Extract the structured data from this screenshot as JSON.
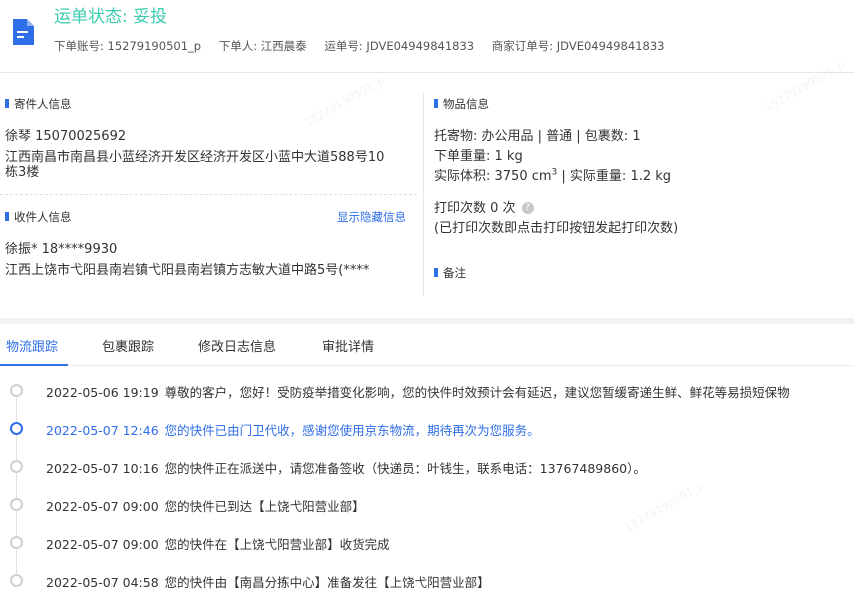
{
  "header": {
    "status_title": "运单状态: 妥投",
    "order_account": "下单账号: 15279190501_p",
    "orderer": "下单人: 江西晨泰",
    "waybill_no": "运单号: JDVE04949841833",
    "merchant_order_no": "商家订单号: JDVE04949841833",
    "icon": "document-icon",
    "title_color": "#3ccdb0"
  },
  "sender": {
    "section_title": "寄件人信息",
    "name_phone": "徐琴   15070025692",
    "address_line1": "江西南昌市南昌县小蓝经济开发区经济开发区小蓝中大道588号10",
    "address_line2": "栋3楼"
  },
  "receiver": {
    "section_title": "收件人信息",
    "toggle_link": "显示隐藏信息",
    "name_phone": "徐振*   18****9930",
    "address": "江西上饶市弋阳县南岩镇弋阳县南岩镇方志敏大道中路5号(****"
  },
  "goods": {
    "section_title": "物品信息",
    "line1": "托寄物:  办公用品 | 普通  |  包裹数:   1",
    "line2": "下单重量:   1 kg",
    "line3_prefix": "实际体积:   3750 cm",
    "line3_sup": "3",
    "line3_suffix": " | 实际重量:   1.2 kg",
    "print_count": "打印次数   0 次",
    "print_note": "(已打印次数即点击打印按钮发起打印次数)"
  },
  "remark": {
    "section_title": "备注"
  },
  "tabs": [
    {
      "label": "物流跟踪"
    },
    {
      "label": "包裹跟踪"
    },
    {
      "label": "修改日志信息"
    },
    {
      "label": "审批详情"
    }
  ],
  "timeline": [
    {
      "time": "2022-05-06 19:19",
      "text": "尊敬的客户，您好！受防疫举措变化影响，您的快件时效预计会有延迟，建议您暂缓寄递生鲜、鲜花等易损短保物"
    },
    {
      "time": "2022-05-07 12:46",
      "text": "您的快件已由门卫代收，感谢您使用京东物流，期待再次为您服务。"
    },
    {
      "time": "2022-05-07 10:16",
      "text": "您的快件正在派送中，请您准备签收（快递员：叶钱生，联系电话：13767489860）。"
    },
    {
      "time": "2022-05-07 09:00",
      "text": "您的快件已到达【上饶弋阳营业部】"
    },
    {
      "time": "2022-05-07 09:00",
      "text": "您的快件在【上饶弋阳营业部】收货完成"
    },
    {
      "time": "2022-05-07 04:58",
      "text": "您的快件由【南昌分拣中心】准备发往【上饶弋阳营业部】"
    }
  ],
  "colors": {
    "accent": "#2e6ee6",
    "status_green": "#3ccdb0"
  }
}
